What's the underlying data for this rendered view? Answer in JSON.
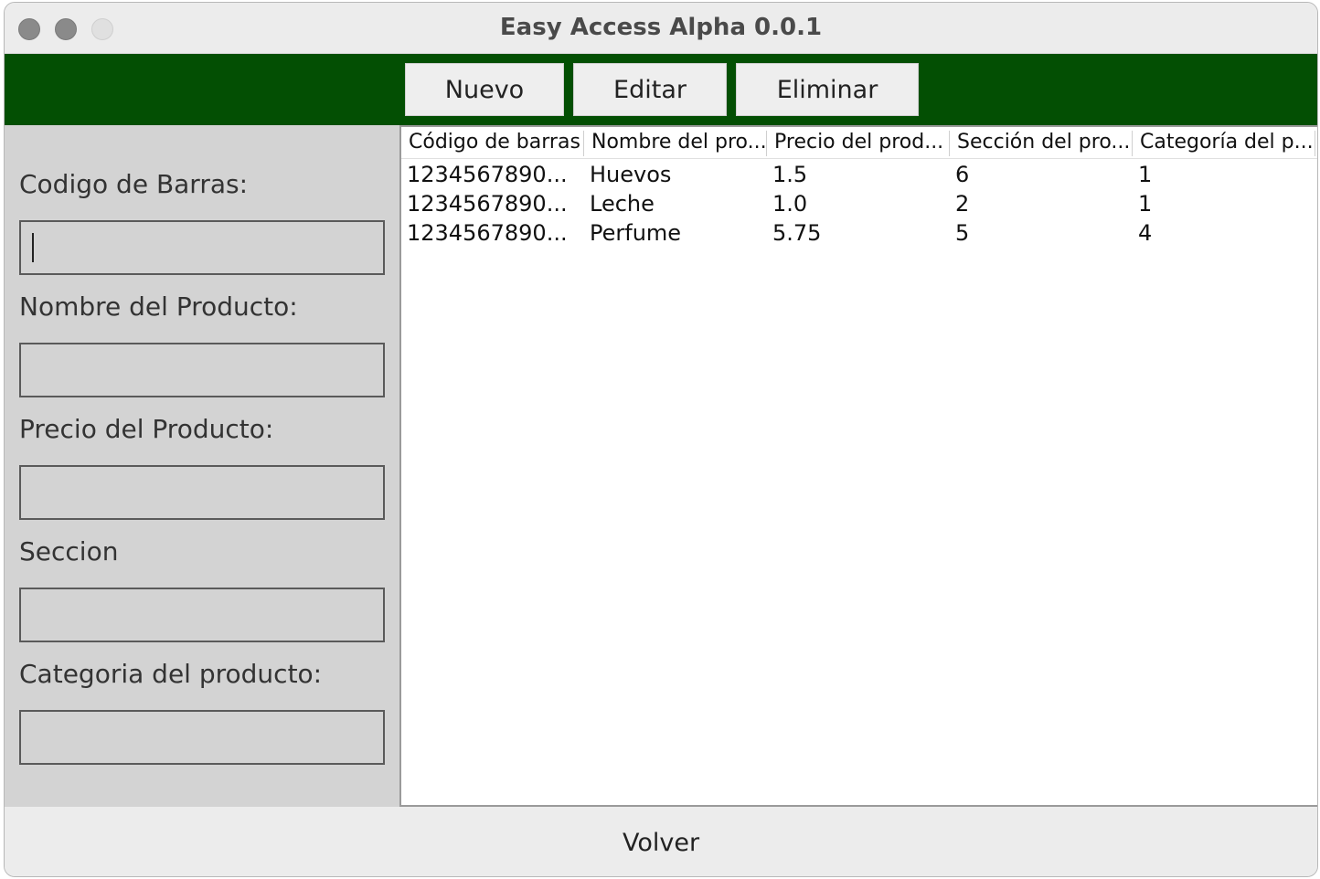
{
  "window": {
    "title": "Easy Access Alpha 0.0.1"
  },
  "toolbar": {
    "nuevo_label": "Nuevo",
    "editar_label": "Editar",
    "eliminar_label": "Eliminar"
  },
  "form": {
    "codigo_label": "Codigo de Barras:",
    "codigo_value": "",
    "nombre_label": "Nombre del Producto:",
    "nombre_value": "",
    "precio_label": "Precio del Producto:",
    "precio_value": "",
    "seccion_label": "Seccion",
    "seccion_value": "",
    "categoria_label": "Categoria del producto:",
    "categoria_value": ""
  },
  "table": {
    "headers": [
      "Código de barras",
      "Nombre del pro...",
      "Precio del prod...",
      "Sección del pro...",
      "Categoría del p..."
    ],
    "rows": [
      [
        "1234567890...",
        "Huevos",
        "1.5",
        "6",
        "1"
      ],
      [
        "1234567890...",
        "Leche",
        "1.0",
        "2",
        "1"
      ],
      [
        "1234567890...",
        "Perfume",
        "5.75",
        "5",
        "4"
      ]
    ]
  },
  "footer": {
    "volver_label": "Volver"
  },
  "colors": {
    "toolbar_bg": "#034f03",
    "form_bg": "#d3d3d3"
  }
}
